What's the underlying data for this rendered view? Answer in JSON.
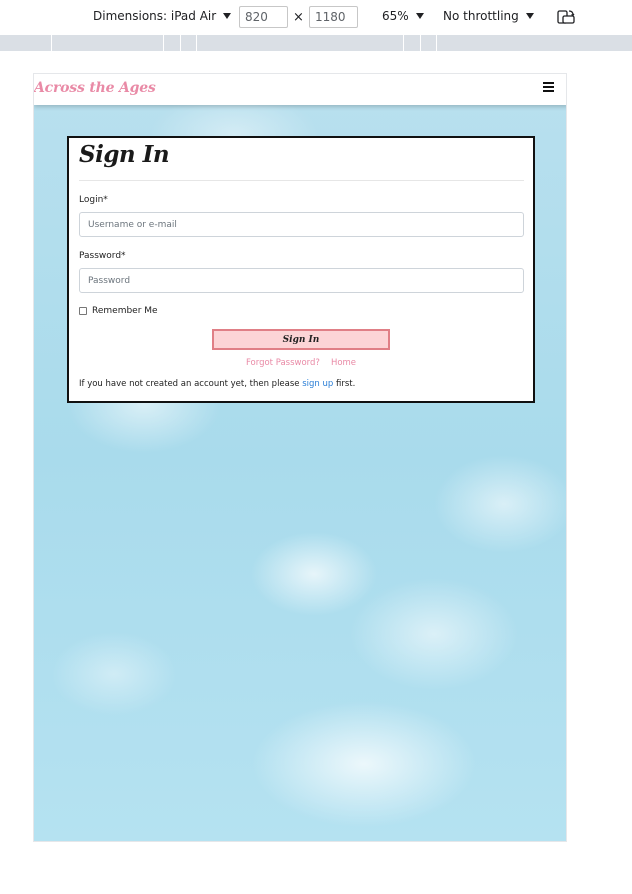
{
  "devtools": {
    "dimensions_label": "Dimensions: iPad Air",
    "width_value": "820",
    "height_value": "1180",
    "times": "×",
    "zoom": "65%",
    "throttling": "No throttling"
  },
  "navbar": {
    "brand": "Across the Ages"
  },
  "signin": {
    "title": "Sign In",
    "login_label": "Login*",
    "login_placeholder": "Username or e-mail",
    "password_label": "Password*",
    "password_placeholder": "Password",
    "remember_label": "Remember Me",
    "button_label": "Sign In",
    "forgot_link": "Forgot Password?",
    "home_link": "Home",
    "note_before": "If you have not created an account yet, then please ",
    "note_link": "sign up",
    "note_after": " first."
  },
  "colors": {
    "brand_pink": "#e98aa6",
    "button_fill": "#fcd4d6",
    "button_border": "#e07f86",
    "link_blue": "#2a7ed6",
    "sky": "#a9dbec"
  }
}
